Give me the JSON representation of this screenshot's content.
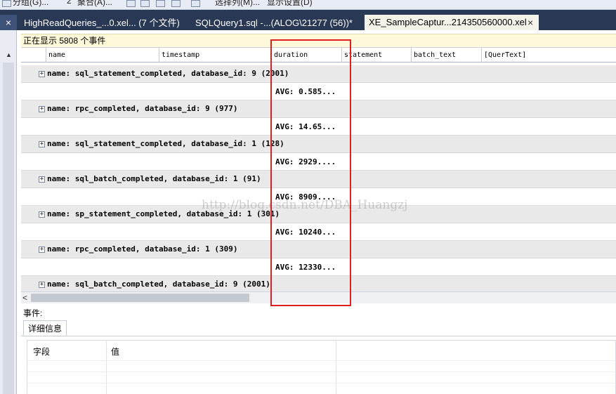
{
  "toolbar": {
    "items": [
      "分组(G)...",
      "2",
      "聚合(A)...",
      "选择列(M)...",
      "显示设置(D)"
    ]
  },
  "tabs": [
    {
      "label": "HighReadQueries_...0.xel... (7 个文件)",
      "active": false
    },
    {
      "label": "SQLQuery1.sql -...(ALOG\\21277 (56))*",
      "active": false
    },
    {
      "label": "XE_SampleCaptur...214350560000.xel",
      "active": true,
      "close": "×"
    }
  ],
  "left_close": "×",
  "status": {
    "text": "正在显示 5808 个事件"
  },
  "columns": [
    "name",
    "timestamp",
    "duration",
    "statement",
    "batch_text",
    "[QuerText]"
  ],
  "groups": [
    {
      "label": "name: sql_statement_completed, database_id: 9  (2001)",
      "avg": "AVG: 0.585..."
    },
    {
      "label": "name: rpc_completed, database_id: 9  (977)",
      "avg": "AVG: 14.65..."
    },
    {
      "label": "name: sql_statement_completed, database_id: 1  (128)",
      "avg": "AVG: 2929...."
    },
    {
      "label": "name: sql_batch_completed, database_id: 1  (91)",
      "avg": "AVG: 8909...."
    },
    {
      "label": "name: sp_statement_completed, database_id: 1  (301)",
      "avg": "AVG: 10240..."
    },
    {
      "label": "name: rpc_completed, database_id: 1  (309)",
      "avg": "AVG: 12330..."
    },
    {
      "label": "name: sql_batch_completed, database_id: 9  (2001)",
      "avg": ""
    }
  ],
  "expander_glyph": "+",
  "scroll_left": "<",
  "watermark": "http://blog.csdn.net/DBA_Huangzj",
  "details": {
    "event_label": "事件:",
    "tab_label": "详细信息",
    "col_field": "字段",
    "col_value": "值"
  },
  "colors": {
    "highlight": "#e02020",
    "tabbar": "#293955",
    "status_bg": "#fff9da",
    "group_bg": "#e9e9e9"
  }
}
